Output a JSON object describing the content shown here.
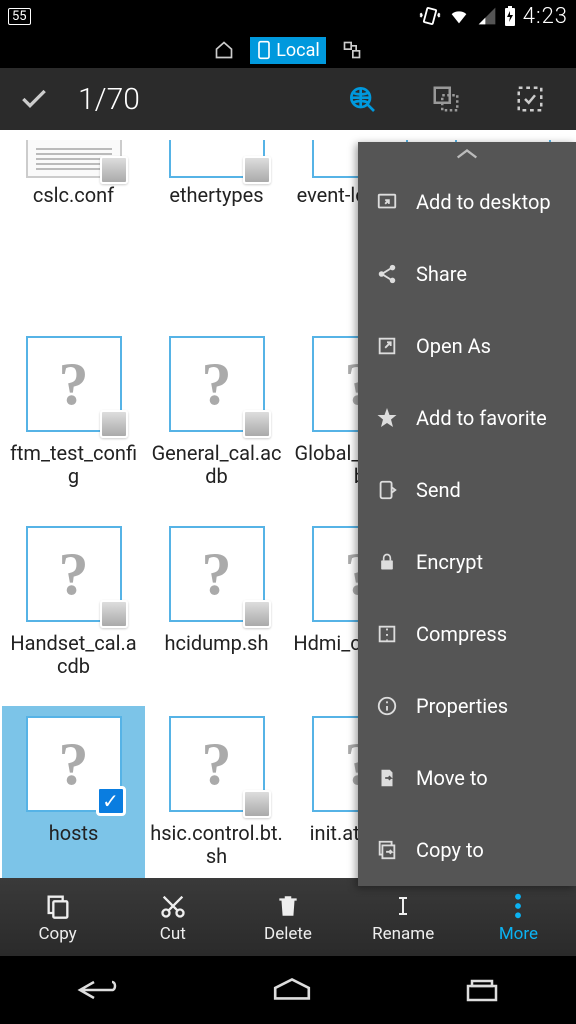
{
  "status": {
    "battery": "55",
    "time": "4:23"
  },
  "location": {
    "label": "Local"
  },
  "selection": {
    "count": "1/70"
  },
  "files": [
    {
      "name": "cslc.conf",
      "type": "text",
      "sel": false,
      "row": 0
    },
    {
      "name": "ethertypes",
      "type": "unknown",
      "sel": false,
      "row": 0
    },
    {
      "name": "event-log-tags",
      "type": "unknown",
      "sel": false,
      "row": 0
    },
    {
      "name": "",
      "type": "unknown",
      "sel": false,
      "row": 0
    },
    {
      "name": "ftm_test_config",
      "type": "unknown",
      "sel": false,
      "row": 1
    },
    {
      "name": "General_cal.acdb",
      "type": "unknown",
      "sel": false,
      "row": 1
    },
    {
      "name": "Global_cal.acdb",
      "type": "unknown",
      "sel": false,
      "row": 1
    },
    {
      "name": "",
      "type": "unknown",
      "sel": false,
      "row": 1
    },
    {
      "name": "Handset_cal.acdb",
      "type": "unknown",
      "sel": false,
      "row": 2
    },
    {
      "name": "hcidump.sh",
      "type": "unknown",
      "sel": false,
      "row": 2
    },
    {
      "name": "Hdmi_cal.acdb",
      "type": "unknown",
      "sel": false,
      "row": 2
    },
    {
      "name": "",
      "type": "unknown",
      "sel": false,
      "row": 2
    },
    {
      "name": "hosts",
      "type": "unknown",
      "sel": true,
      "row": 3
    },
    {
      "name": "hsic.control.bt.sh",
      "type": "unknown",
      "sel": false,
      "row": 3
    },
    {
      "name": "init.at.bt.sh",
      "type": "unknown",
      "sel": false,
      "row": 3
    },
    {
      "name": "",
      "type": "unknown",
      "sel": false,
      "row": 3
    }
  ],
  "menu": {
    "items": [
      {
        "label": "Add to desktop",
        "icon": "desktop"
      },
      {
        "label": "Share",
        "icon": "share"
      },
      {
        "label": "Open As",
        "icon": "open"
      },
      {
        "label": "Add to favorite",
        "icon": "star"
      },
      {
        "label": "Send",
        "icon": "send"
      },
      {
        "label": "Encrypt",
        "icon": "lock"
      },
      {
        "label": "Compress",
        "icon": "compress"
      },
      {
        "label": "Properties",
        "icon": "info"
      },
      {
        "label": "Move to",
        "icon": "move"
      },
      {
        "label": "Copy to",
        "icon": "copyto"
      }
    ]
  },
  "toolbar": {
    "copy": "Copy",
    "cut": "Cut",
    "delete": "Delete",
    "rename": "Rename",
    "more": "More"
  }
}
